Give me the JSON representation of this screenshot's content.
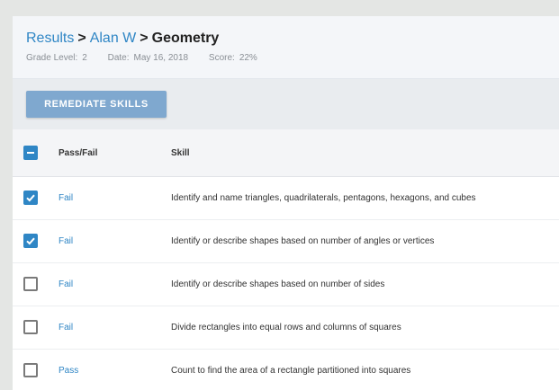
{
  "breadcrumb": {
    "items": [
      "Results",
      "Alan W",
      "Geometry"
    ],
    "separator": ">"
  },
  "meta": {
    "grade_label": "Grade Level:",
    "grade_value": "2",
    "date_label": "Date:",
    "date_value": "May 16, 2018",
    "score_label": "Score:",
    "score_value": "22%"
  },
  "toolbar": {
    "remediate_label": "REMEDIATE SKILLS"
  },
  "table": {
    "headers": {
      "pass_fail": "Pass/Fail",
      "skill": "Skill"
    },
    "select_all_state": "indeterminate",
    "rows": [
      {
        "checked": true,
        "status": "Fail",
        "skill": "Identify and name triangles, quadrilaterals, pentagons, hexagons, and cubes"
      },
      {
        "checked": true,
        "status": "Fail",
        "skill": "Identify or describe shapes based on number of angles or vertices"
      },
      {
        "checked": false,
        "status": "Fail",
        "skill": "Identify or describe shapes based on number of sides"
      },
      {
        "checked": false,
        "status": "Fail",
        "skill": "Divide rectangles into equal rows and columns of squares"
      },
      {
        "checked": false,
        "status": "Pass",
        "skill": "Count to find the area of a rectangle partitioned into squares"
      }
    ]
  },
  "colors": {
    "accent": "#2f86c5",
    "button": "#7fa8cf",
    "header_bg": "#f4f6f9",
    "page_bg": "#e4e6e4"
  },
  "icons": {
    "select_all": "minus-icon",
    "checked": "checkmark-icon"
  }
}
